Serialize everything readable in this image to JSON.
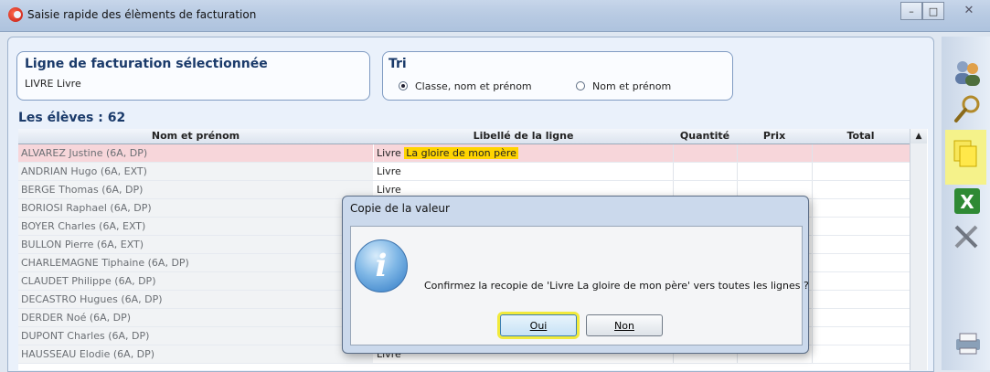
{
  "window": {
    "title": "Saisie rapide des élèments de facturation"
  },
  "selected_line": {
    "label": "Ligne de facturation sélectionnée",
    "value": "LIVRE Livre"
  },
  "tri": {
    "label": "Tri",
    "options": [
      {
        "label": "Classe, nom et prénom",
        "checked": true
      },
      {
        "label": "Nom et prénom",
        "checked": false
      }
    ]
  },
  "students": {
    "label": "Les élèves : 62"
  },
  "table": {
    "headers": [
      "Nom et prénom",
      "Libellé de la ligne",
      "Quantité",
      "Prix",
      "Total"
    ],
    "rows": [
      {
        "name": "ALVAREZ Justine   (6A, DP)",
        "libelle": "Livre",
        "highlight": "La gloire de mon père"
      },
      {
        "name": "ANDRIAN Hugo   (6A, EXT)",
        "libelle": "Livre"
      },
      {
        "name": "BERGE Thomas   (6A, DP)",
        "libelle": "Livre"
      },
      {
        "name": "BORIOSI Raphael   (6A, DP)",
        "libelle": ""
      },
      {
        "name": "BOYER Charles   (6A, EXT)",
        "libelle": ""
      },
      {
        "name": "BULLON Pierre   (6A, EXT)",
        "libelle": ""
      },
      {
        "name": "CHARLEMAGNE Tiphaine   (6A, DP)",
        "libelle": ""
      },
      {
        "name": "CLAUDET Philippe   (6A, DP)",
        "libelle": ""
      },
      {
        "name": "DECASTRO Hugues   (6A, DP)",
        "libelle": ""
      },
      {
        "name": "DERDER Noé   (6A, DP)",
        "libelle": ""
      },
      {
        "name": "DUPONT Charles   (6A, DP)",
        "libelle": ""
      },
      {
        "name": "HAUSSEAU Elodie   (6A, DP)",
        "libelle": "Livre"
      }
    ]
  },
  "toolbar": {
    "icons": [
      "users-icon",
      "search-icon",
      "copy-icon",
      "excel-icon",
      "tools-icon",
      "print-icon"
    ]
  },
  "dialog": {
    "title": "Copie de la valeur",
    "message": "Confirmez la recopie de 'Livre La gloire de mon père' vers toutes les lignes ?",
    "yes_label": "Oui",
    "no_label": "Non"
  },
  "colors": {
    "selected_row": "#f7d6da",
    "highlight": "#ffd400",
    "title_blue": "#1a3a6a",
    "focus_glow": "#f1ea3c"
  }
}
